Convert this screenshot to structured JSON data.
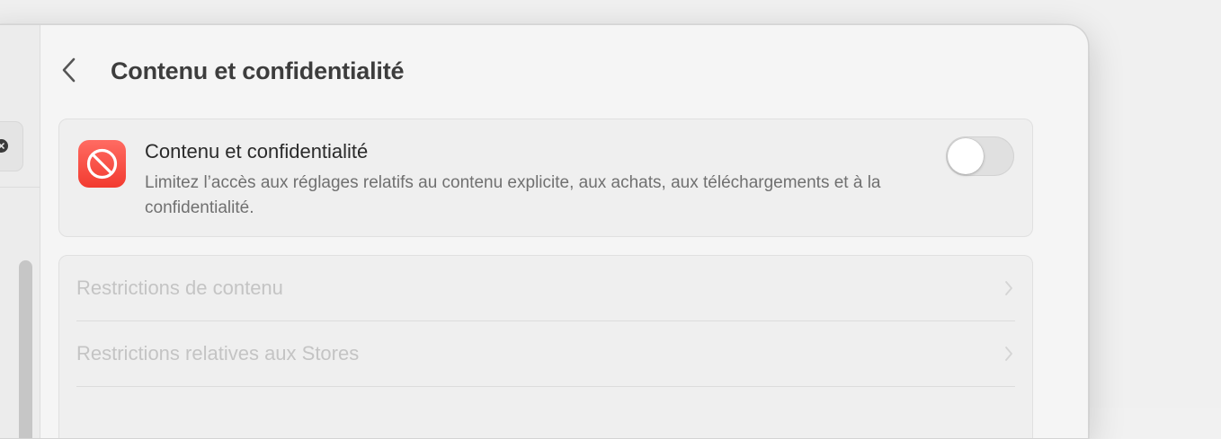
{
  "page": {
    "title": "Contenu et confidentialité"
  },
  "main_card": {
    "title": "Contenu et confidentialité",
    "description": "Limitez l’accès aux réglages relatifs au contenu explicite, aux achats, aux téléchargements et à la confidentialité.",
    "icon": "no-entry-icon",
    "toggle_on": false,
    "accent_color": "#f23b30"
  },
  "restrictions": {
    "items": [
      {
        "label": "Restrictions de contenu",
        "enabled": false
      },
      {
        "label": "Restrictions relatives aux Stores",
        "enabled": false
      }
    ]
  },
  "sidebar": {
    "search_clear_icon": "clear-icon"
  }
}
